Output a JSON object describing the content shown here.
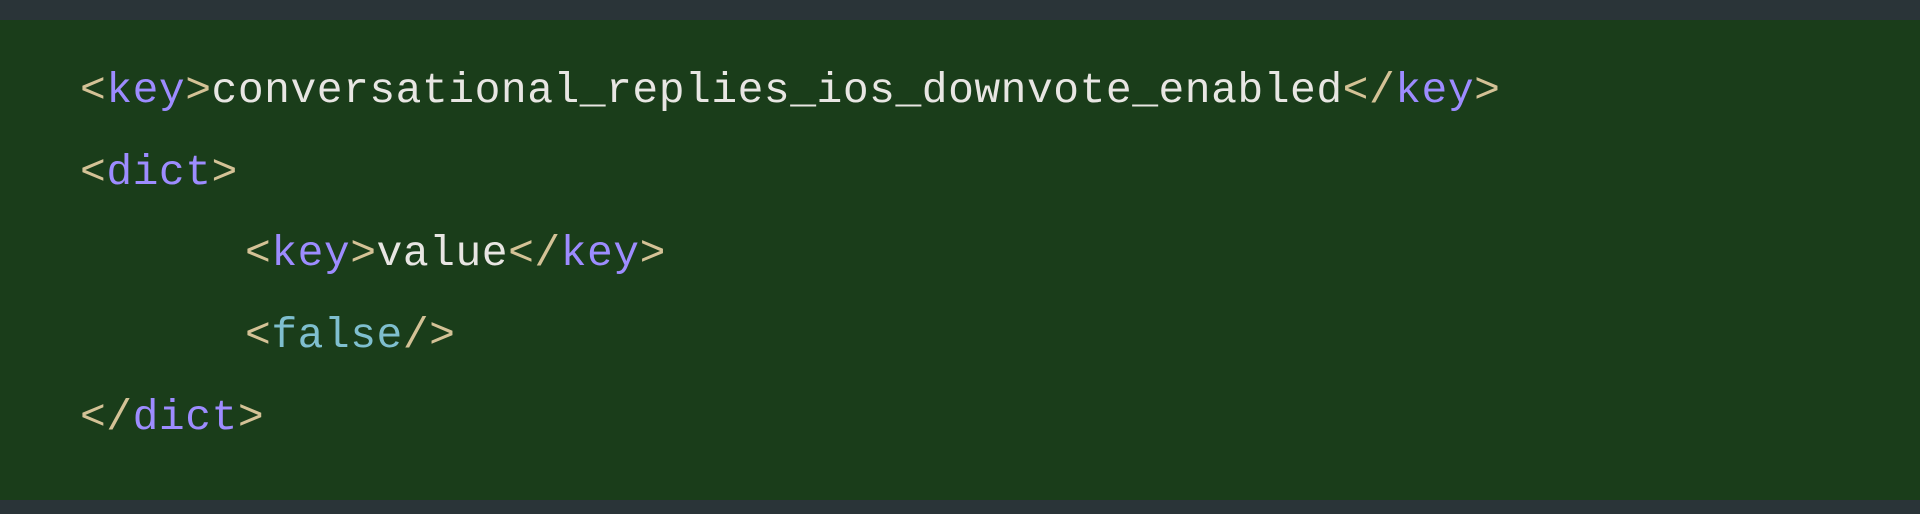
{
  "colors": {
    "background": "#1a3d1a",
    "topBar": "#2a3438",
    "bracket": "#d4c296",
    "tag": "#9d8cff",
    "text": "#e8e6e3",
    "bool": "#7fbfcf"
  },
  "code": {
    "line1": {
      "openBracket1": "<",
      "tag1": "key",
      "closeBracket1": ">",
      "content": "conversational_replies_ios_downvote_enabled",
      "openBracket2": "</",
      "tag2": "key",
      "closeBracket2": ">"
    },
    "line2": {
      "openBracket": "<",
      "tag": "dict",
      "closeBracket": ">"
    },
    "line3": {
      "openBracket1": "<",
      "tag1": "key",
      "closeBracket1": ">",
      "content": "value",
      "openBracket2": "</",
      "tag2": "key",
      "closeBracket2": ">"
    },
    "line4": {
      "openBracket": "<",
      "tag": "false",
      "selfClose": "/>",
      "closeBracket": ""
    },
    "line5": {
      "openBracket": "</",
      "tag": "dict",
      "closeBracket": ">"
    }
  }
}
